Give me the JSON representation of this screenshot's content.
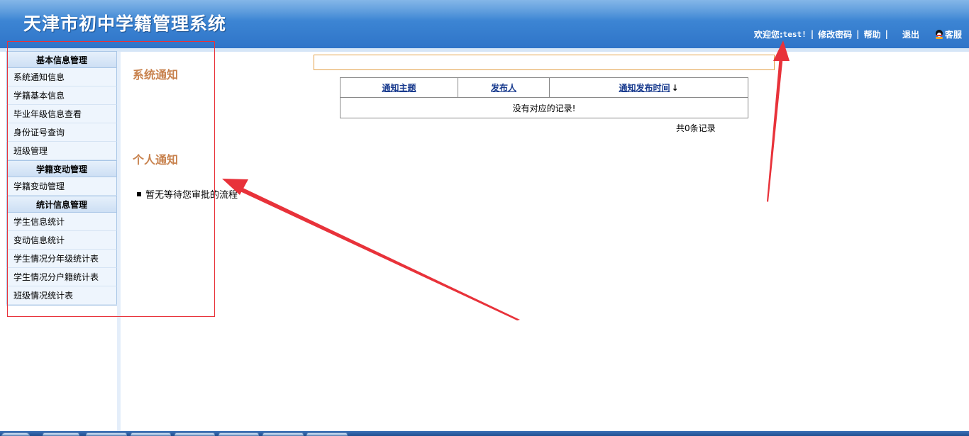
{
  "header": {
    "title": "天津市初中学籍管理系统",
    "welcome_prefix": "欢迎您:",
    "username": "test!",
    "links": {
      "change_password": "修改密码",
      "help": "帮助",
      "logout": "退出",
      "customer_service": "客服"
    },
    "separator": "|"
  },
  "sidebar": {
    "groups": [
      {
        "title": "基本信息管理",
        "items": [
          "系统通知信息",
          "学籍基本信息",
          "毕业年级信息查看",
          "身份证号查询",
          "班级管理"
        ]
      },
      {
        "title": "学籍变动管理",
        "items": [
          "学籍变动管理"
        ]
      },
      {
        "title": "统计信息管理",
        "items": [
          "学生信息统计",
          "变动信息统计",
          "学生情况分年级统计表",
          "学生情况分户籍统计表",
          "班级情况统计表"
        ]
      }
    ]
  },
  "main": {
    "system_notice_heading": "系统通知",
    "personal_notice_heading": "个人通知",
    "personal_notice_empty": "暂无等待您审批的流程",
    "notice_table": {
      "columns": [
        "通知主题",
        "发布人",
        "通知发布时间"
      ],
      "sort_indicator": "↓",
      "empty_message": "没有对应的记录!"
    },
    "record_count": "共0条记录"
  },
  "colors": {
    "header_blue": "#3d86d4",
    "heading_orange": "#c8824e",
    "annotation_red": "#e8323a",
    "notice_border": "#e3a24a"
  },
  "icons": {
    "qq": "qq-penguin-icon",
    "sort": "arrow-down-icon"
  }
}
